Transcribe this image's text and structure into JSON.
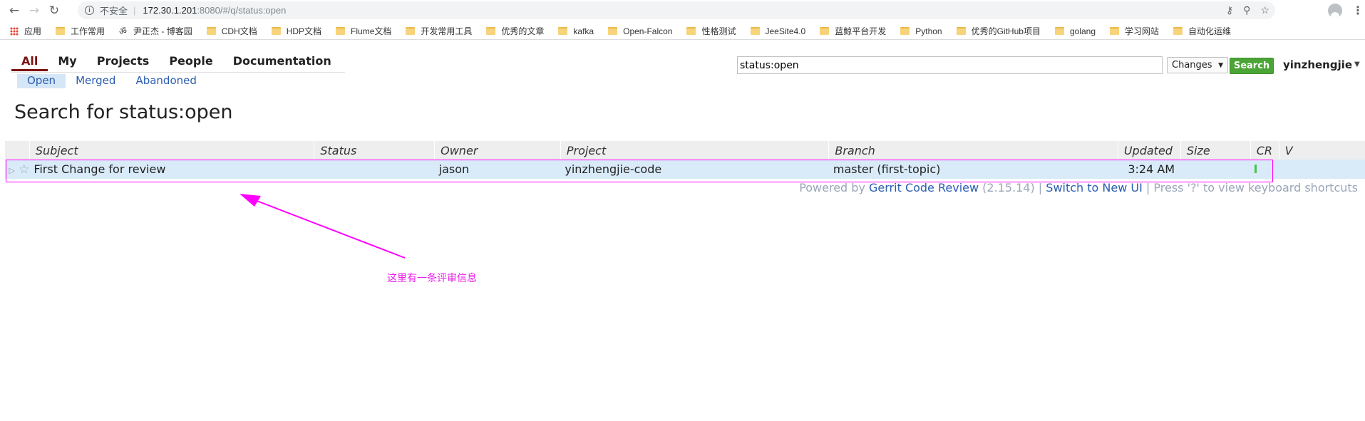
{
  "browser": {
    "url_insecure_label": "不安全",
    "url_host": "172.30.1.201",
    "url_path": ":8080/#/q/status:open",
    "bookmarks": [
      {
        "label": "应用",
        "icon": "apps-grid-icon"
      },
      {
        "label": "工作常用",
        "icon": "folder-icon"
      },
      {
        "label": "尹正杰 - 博客园",
        "icon": "blog-icon"
      },
      {
        "label": "CDH文档",
        "icon": "folder-icon"
      },
      {
        "label": "HDP文档",
        "icon": "folder-icon"
      },
      {
        "label": "Flume文档",
        "icon": "folder-icon"
      },
      {
        "label": "开发常用工具",
        "icon": "folder-icon"
      },
      {
        "label": "优秀的文章",
        "icon": "folder-icon"
      },
      {
        "label": "kafka",
        "icon": "folder-icon"
      },
      {
        "label": "Open-Falcon",
        "icon": "folder-icon"
      },
      {
        "label": "性格测试",
        "icon": "folder-icon"
      },
      {
        "label": "JeeSite4.0",
        "icon": "folder-icon"
      },
      {
        "label": "蓝鲸平台开发",
        "icon": "folder-icon"
      },
      {
        "label": "Python",
        "icon": "folder-icon"
      },
      {
        "label": "优秀的GitHub项目",
        "icon": "folder-icon"
      },
      {
        "label": "golang",
        "icon": "folder-icon"
      },
      {
        "label": "学习网站",
        "icon": "folder-icon"
      },
      {
        "label": "自动化运维",
        "icon": "folder-icon"
      }
    ]
  },
  "topmenu": [
    "All",
    "My",
    "Projects",
    "People",
    "Documentation"
  ],
  "submenu": [
    "Open",
    "Merged",
    "Abandoned"
  ],
  "search": {
    "query": "status:open",
    "type_label": "Changes",
    "button_label": "Search"
  },
  "user": {
    "name": "yinzhengjie"
  },
  "page_title": "Search for status:open",
  "table": {
    "columns": [
      "Subject",
      "Status",
      "Owner",
      "Project",
      "Branch",
      "Updated",
      "Size",
      "CR",
      "V"
    ],
    "rows": [
      {
        "subject": "First Change for review",
        "status": "",
        "owner": "jason",
        "project": "yinzhengjie-code",
        "branch": "master (first-topic)",
        "updated": "3:24 AM",
        "size": "",
        "cr": "approved",
        "v": ""
      }
    ]
  },
  "footer": {
    "powered_by": "Powered by ",
    "gerrit_link": "Gerrit Code Review",
    "version": " (2.15.14) | ",
    "switch_link": "Switch to New UI",
    "shortcut_hint": " | Press '?' to view keyboard shortcuts"
  },
  "annotation": {
    "text": "这里有一条评审信息",
    "color": "#ff00ff"
  },
  "colors": {
    "active_menu": "#7a1414",
    "link": "#2a5db0",
    "row_highlight": "#d9ebf9",
    "search_button": "#4aa536"
  }
}
